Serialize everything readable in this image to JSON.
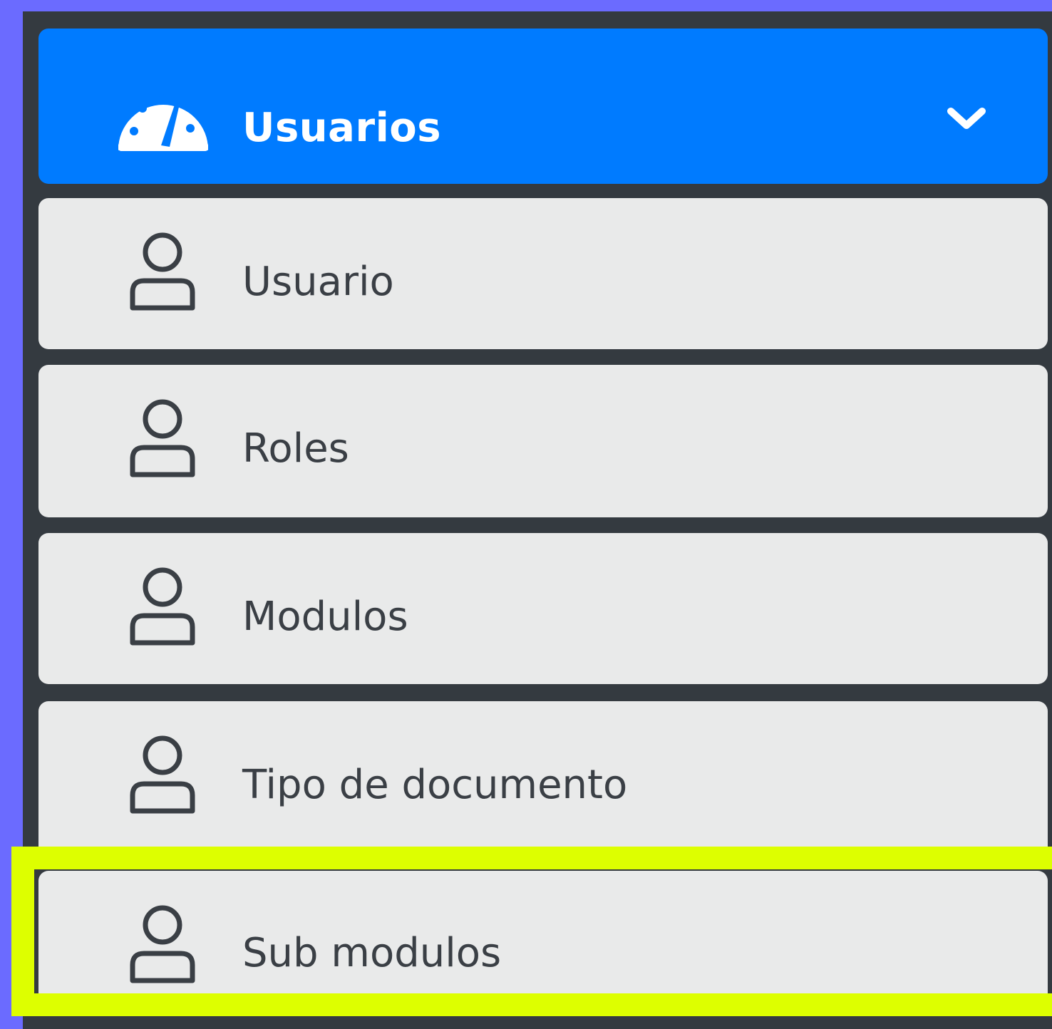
{
  "sidebar": {
    "header": {
      "label": "Usuarios",
      "icon": "tachometer-icon",
      "expand_icon": "chevron-down-icon",
      "background_color": "#007bff"
    },
    "items": [
      {
        "label": "Usuario",
        "icon": "user-icon"
      },
      {
        "label": "Roles",
        "icon": "user-icon"
      },
      {
        "label": "Modulos",
        "icon": "user-icon"
      },
      {
        "label": "Tipo de documento",
        "icon": "user-icon"
      },
      {
        "label": "Sub modulos",
        "icon": "user-icon"
      }
    ],
    "highlight_color": "#ddff00"
  }
}
